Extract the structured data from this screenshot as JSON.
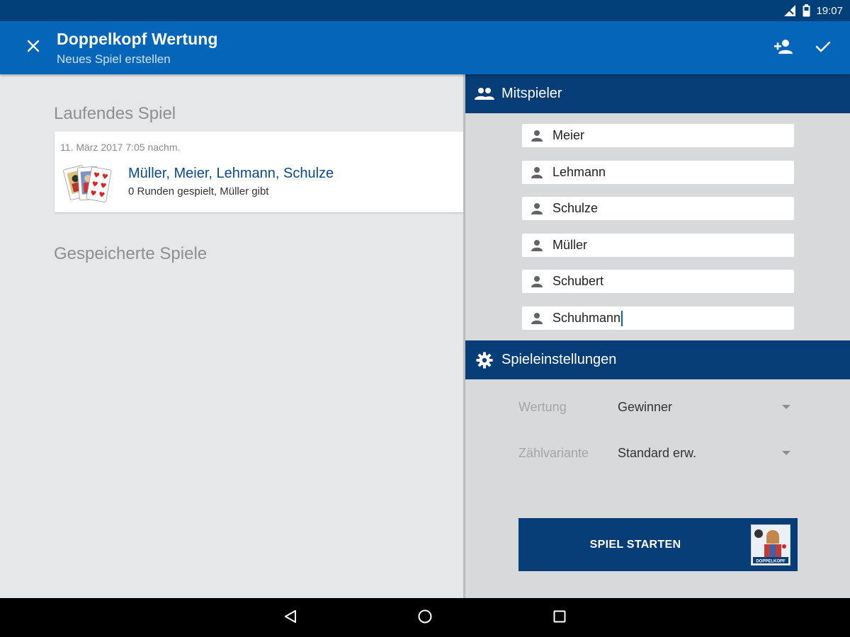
{
  "status_bar": {
    "time": "19:07"
  },
  "app_bar": {
    "title": "Doppelkopf Wertung",
    "subtitle": "Neues Spiel erstellen"
  },
  "running_game": {
    "section_title": "Laufendes Spiel",
    "date": "11. März 2017 7:05 nachm.",
    "players": "Müller, Meier, Lehmann, Schulze",
    "info": "0 Runden gespielt, Müller gibt"
  },
  "saved_games": {
    "section_title": "Gespeicherte Spiele"
  },
  "players_section": {
    "title": "Mitspieler",
    "players": [
      "Meier",
      "Lehmann",
      "Schulze",
      "Müller",
      "Schubert",
      "Schuhmann"
    ]
  },
  "settings_section": {
    "title": "Spieleinstellungen",
    "rows": [
      {
        "label": "Wertung",
        "value": "Gewinner"
      },
      {
        "label": "Zählvariante",
        "value": "Standard erw."
      }
    ]
  },
  "start_button": {
    "label": "SPIEL STARTEN",
    "logo_text": "DOPPELKOPF"
  },
  "colors": {
    "status_bar": "#003f78",
    "app_bar": "#0565b8",
    "section_header": "#063d77",
    "player_link": "#0b4a8e"
  },
  "icons": {
    "close": "close-icon",
    "add_person": "person-add-icon",
    "confirm": "check-icon",
    "players_header": "group-icon",
    "player_field": "person-icon",
    "settings_header": "gear-icon"
  }
}
